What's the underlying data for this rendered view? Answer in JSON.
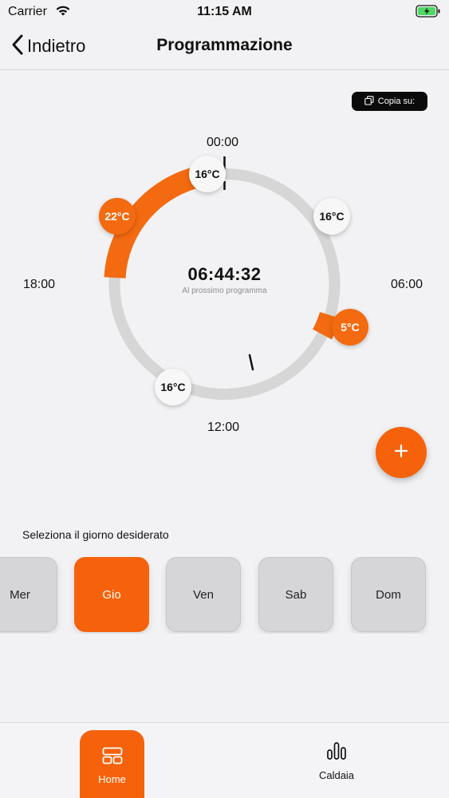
{
  "status_bar": {
    "carrier": "Carrier",
    "time": "11:15 AM"
  },
  "nav": {
    "back_label": "Indietro",
    "title": "Programmazione"
  },
  "copy_button": {
    "label": "Copia su:"
  },
  "dial": {
    "hour_labels": {
      "top": "00:00",
      "right": "06:00",
      "bottom": "12:00",
      "left": "18:00"
    },
    "countdown": "06:44:32",
    "countdown_caption": "Al prossimo programma",
    "knobs": [
      {
        "label": "16°C"
      },
      {
        "label": "16°C"
      },
      {
        "label": "5°C"
      },
      {
        "label": "16°C"
      },
      {
        "label": "22°C"
      }
    ]
  },
  "day_prompt": "Seleziona il giorno desiderato",
  "days": [
    {
      "label": "Mer",
      "selected": false
    },
    {
      "label": "Gio",
      "selected": true
    },
    {
      "label": "Ven",
      "selected": false
    },
    {
      "label": "Sab",
      "selected": false
    },
    {
      "label": "Dom",
      "selected": false
    }
  ],
  "tabs": [
    {
      "label": "Home",
      "icon": "home-grid-icon",
      "active": true
    },
    {
      "label": "Caldaia",
      "icon": "bar-chart-icon",
      "active": false
    }
  ],
  "colors": {
    "accent": "#f5620b",
    "track": "#d6d6d6"
  }
}
